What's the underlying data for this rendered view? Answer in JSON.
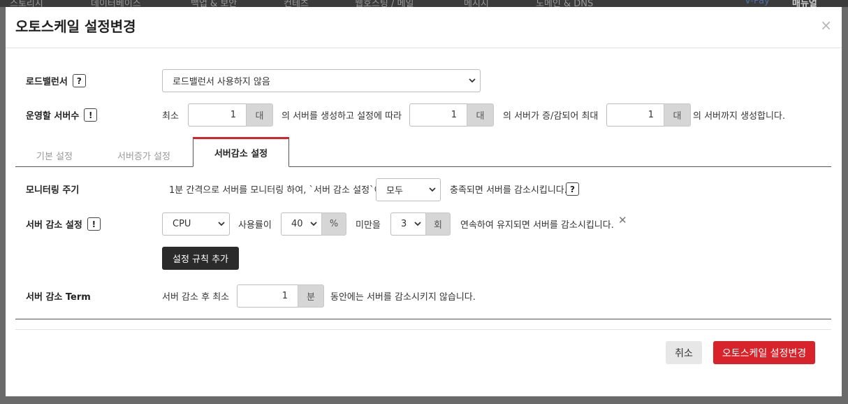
{
  "background": {
    "nav_items": [
      "스토리지",
      "데이터베이스",
      "백업 & 보안",
      "컨테츠",
      "웹호스팅 / 메일",
      "메시지",
      "도메인 & DNS",
      "V-Pay",
      "매뉴얼"
    ]
  },
  "modal": {
    "title": "오토스케일 설정변경",
    "close_symbol": "×",
    "load_balancer": {
      "label": "로드밸런서",
      "help": "?",
      "selected": "로드밸런서 사용하지 않음"
    },
    "servers": {
      "label": "운영할 서버수",
      "help": "!",
      "text_min": "최소",
      "min_value": "1",
      "unit": "대",
      "text_mid": "의 서버를 생성하고 설정에 따라",
      "change_value": "1",
      "text_mid2": "의 서버가 증/감되어 최대",
      "max_value": "1",
      "text_end": "의 서버까지 생성합니다."
    },
    "tabs": [
      {
        "label": "기본 설정"
      },
      {
        "label": "서버증가 설정"
      },
      {
        "label": "서버감소 설정"
      }
    ],
    "monitoring": {
      "label": "모니터링 주기",
      "text": "1분 간격으로 서버를 모니터링 하여, `서버 감소 설정`이",
      "selected": "모두",
      "text_end": "충족되면 서버를 감소시킵니다.",
      "help": "?"
    },
    "reduce_rule": {
      "label": "서버 감소 설정",
      "help": "!",
      "metric": "CPU",
      "text_usage": "사용률이",
      "percent": "40",
      "percent_unit": "%",
      "text_below": "미만을",
      "count": "3",
      "count_unit": "회",
      "text_end": "연속하여 유지되면 서버를 감소시킵니다.",
      "remove_symbol": "✕",
      "add_rule_label": "설정 규칙 추가"
    },
    "term": {
      "label": "서버 감소 Term",
      "text": "서버 감소 후 최소",
      "value": "1",
      "unit": "분",
      "text_end": "동안에는 서버를 감소시키지 않습니다."
    },
    "footer": {
      "cancel_label": "취소",
      "confirm_label": "오토스케일 설정변경"
    }
  },
  "colors": {
    "accent_red": "#d8232a",
    "dark_button": "#2b2b2b",
    "unit_gray": "#d6d6d6"
  }
}
